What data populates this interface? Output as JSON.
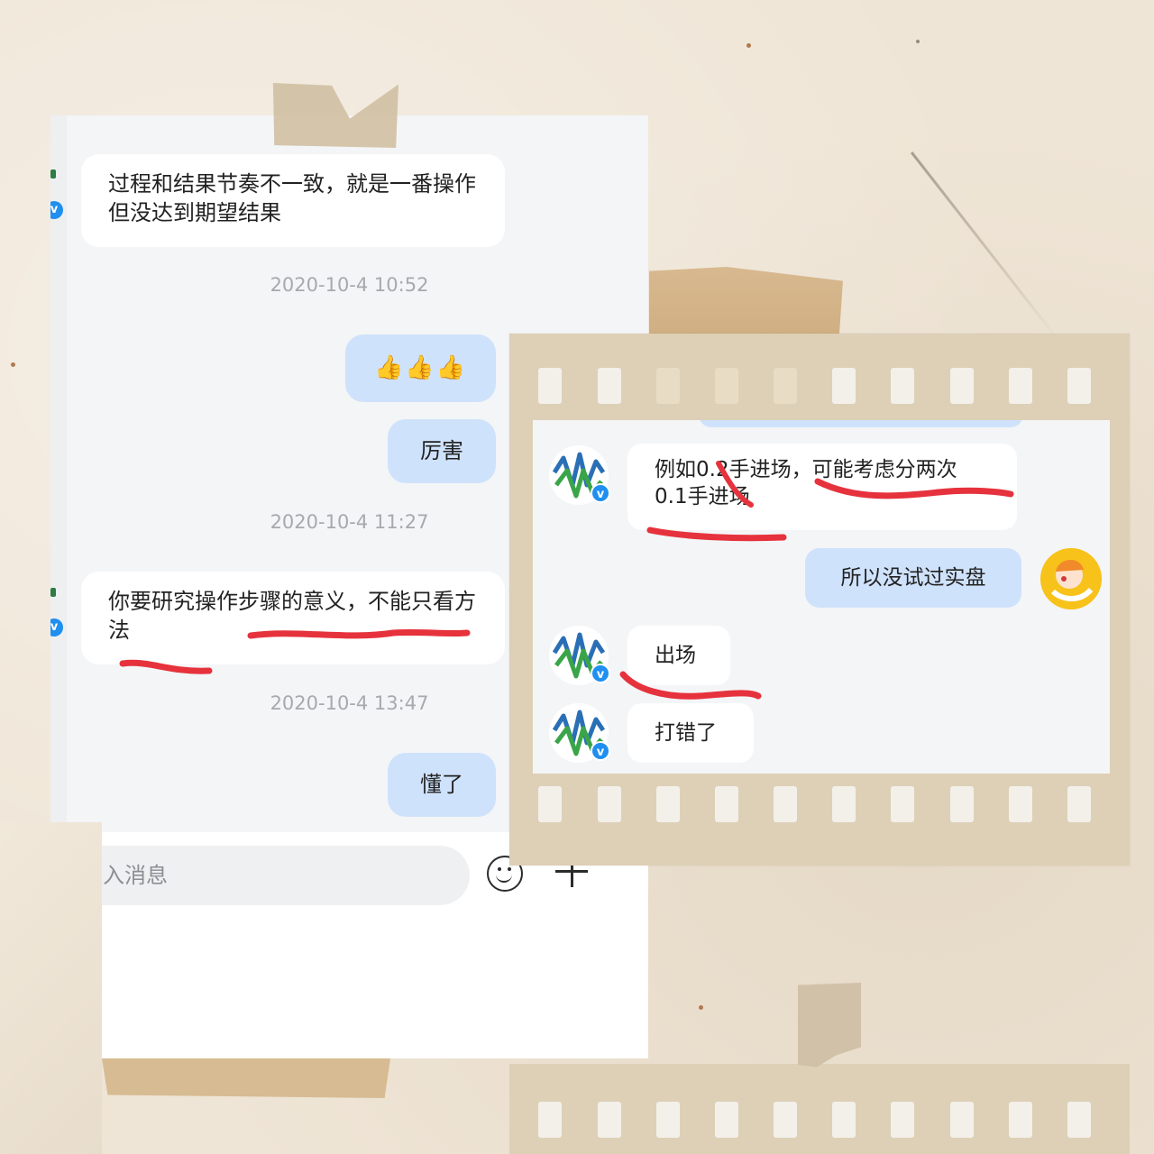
{
  "left_chat": {
    "messages": [
      {
        "type": "in",
        "text": "过程和结果节奏不一致，就是一番操作但没达到期望结果"
      },
      {
        "type": "time",
        "text": "2020-10-4 10:52"
      },
      {
        "type": "out",
        "text": "👍👍👍"
      },
      {
        "type": "out",
        "text": "厉害"
      },
      {
        "type": "time",
        "text": "2020-10-4 11:27"
      },
      {
        "type": "in",
        "text": "你要研究操作步骤的意义，不能只看方法"
      },
      {
        "type": "time",
        "text": "2020-10-4 13:47"
      },
      {
        "type": "out",
        "text": "懂了"
      }
    ],
    "input_placeholder": "入消息"
  },
  "film_chat": {
    "messages": [
      {
        "type": "in",
        "text": "例如0.2手进场，可能考虑分两次0.1手进场"
      },
      {
        "type": "out",
        "text": "所以没试过实盘"
      },
      {
        "type": "in",
        "text": "出场"
      },
      {
        "type": "in",
        "text": "打错了"
      }
    ]
  },
  "icons": {
    "verified_badge": "verified-v-icon",
    "emoji": "smiley-icon",
    "plus": "plus-icon"
  },
  "colors": {
    "incoming_bubble": "#ffffff",
    "outgoing_bubble": "#cfe2fb",
    "annotation_red": "#e6323c",
    "chat_background": "#f4f5f7",
    "timestamp": "#a7a9ad"
  }
}
